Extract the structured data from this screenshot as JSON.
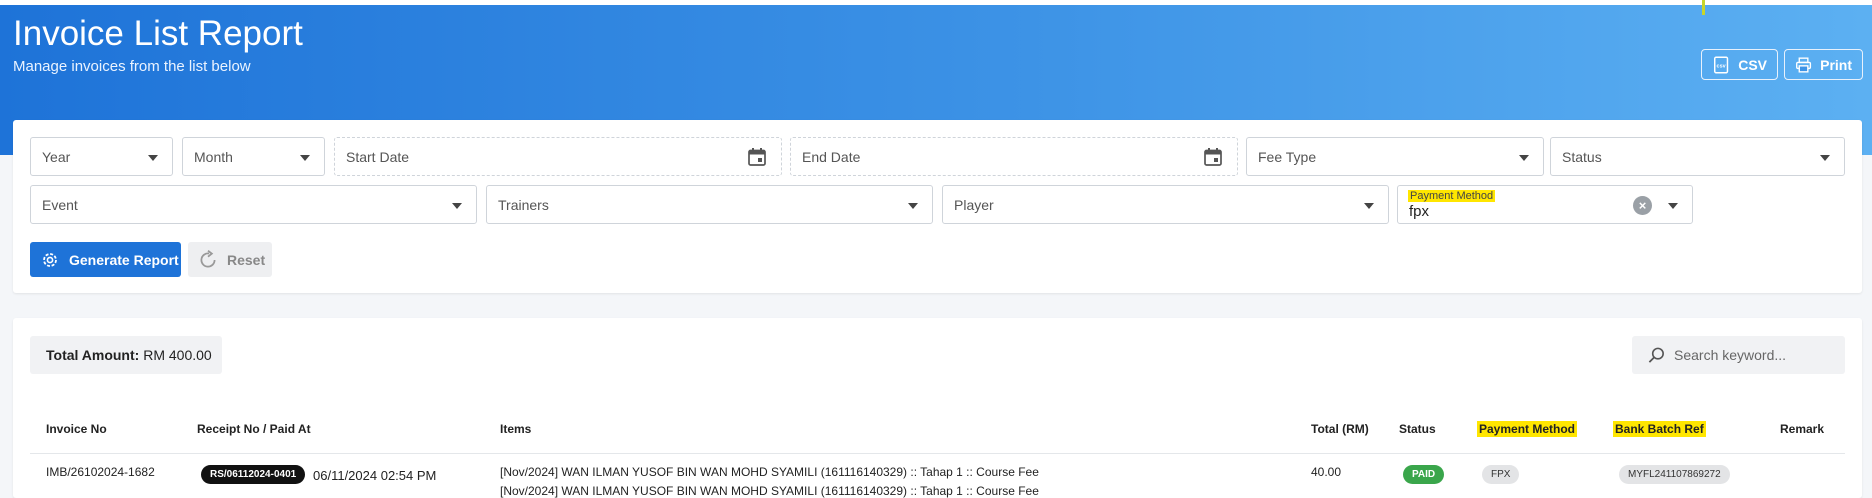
{
  "header": {
    "title": "Invoice List Report",
    "subtitle": "Manage invoices from the list below",
    "csv_label": "CSV",
    "print_label": "Print"
  },
  "filters": {
    "year": "Year",
    "month": "Month",
    "start_date": "Start Date",
    "end_date": "End Date",
    "fee_type": "Fee Type",
    "status": "Status",
    "event": "Event",
    "trainers": "Trainers",
    "player": "Player",
    "payment_method_label": "Payment Method",
    "payment_method_value": "fpx"
  },
  "actions": {
    "generate": "Generate Report",
    "reset": "Reset"
  },
  "summary": {
    "total_label": "Total Amount:",
    "total_value": "RM 400.00"
  },
  "search": {
    "placeholder": "Search keyword..."
  },
  "table": {
    "columns": [
      "Invoice No",
      "Receipt No / Paid At",
      "Items",
      "Total (RM)",
      "Status",
      "Payment Method",
      "Bank Batch Ref",
      "Remark"
    ],
    "rows": [
      {
        "invoice_no": "IMB/26102024-1682",
        "receipt_no": "RS/06112024-0401",
        "paid_at": "06/11/2024 02:54 PM",
        "items": [
          "[Nov/2024] WAN ILMAN YUSOF BIN WAN MOHD SYAMILI (161116140329) :: Tahap 1 :: Course Fee",
          "[Nov/2024] WAN ILMAN YUSOF BIN WAN MOHD SYAMILI (161116140329) :: Tahap 1 :: Course Fee"
        ],
        "total": "40.00",
        "status": "PAID",
        "payment_method": "FPX",
        "bank_batch_ref": "MYFL241107869272",
        "remark": ""
      }
    ]
  },
  "colors": {
    "banner_start": "#1e73d8",
    "banner_end": "#5cb0f2",
    "primary": "#1e73d8",
    "paid": "#3aa64b",
    "highlight": "#ffe600"
  }
}
